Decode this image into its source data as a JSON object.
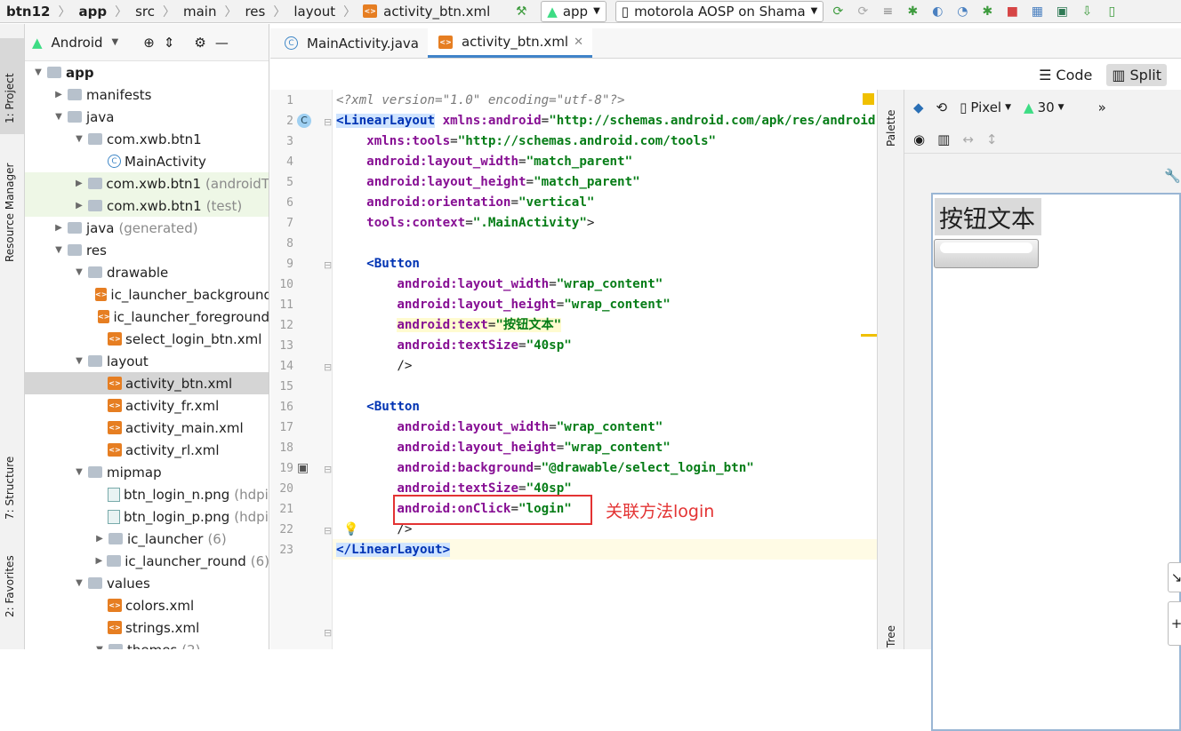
{
  "breadcrumb": [
    "btn12",
    "app",
    "src",
    "main",
    "res",
    "layout",
    "activity_btn.xml"
  ],
  "toolbar": {
    "config": "app",
    "device": "motorola AOSP on Shama"
  },
  "sidebar_tabs": {
    "project": "1: Project",
    "resource_manager": "Resource Manager",
    "structure": "7: Structure",
    "favorites": "2: Favorites"
  },
  "project_panel": {
    "view": "Android"
  },
  "tree": [
    {
      "label": "app",
      "extra": "",
      "indent": 0,
      "icon": "folder",
      "arrow": "down",
      "bold": true
    },
    {
      "label": "manifests",
      "extra": "",
      "indent": 1,
      "icon": "folder",
      "arrow": "right"
    },
    {
      "label": "java",
      "extra": "",
      "indent": 1,
      "icon": "folder",
      "arrow": "down"
    },
    {
      "label": "com.xwb.btn1",
      "extra": "",
      "indent": 2,
      "icon": "folder",
      "arrow": "down"
    },
    {
      "label": "MainActivity",
      "extra": "",
      "indent": 3,
      "icon": "class",
      "arrow": ""
    },
    {
      "label": "com.xwb.btn1",
      "extra": "(androidT",
      "indent": 2,
      "icon": "folder",
      "arrow": "right",
      "test": true
    },
    {
      "label": "com.xwb.btn1",
      "extra": "(test)",
      "indent": 2,
      "icon": "folder",
      "arrow": "right",
      "test": true
    },
    {
      "label": "java",
      "extra": "(generated)",
      "indent": 1,
      "icon": "folder",
      "arrow": "right"
    },
    {
      "label": "res",
      "extra": "",
      "indent": 1,
      "icon": "folder",
      "arrow": "down"
    },
    {
      "label": "drawable",
      "extra": "",
      "indent": 2,
      "icon": "folder",
      "arrow": "down"
    },
    {
      "label": "ic_launcher_background",
      "extra": "",
      "indent": 3,
      "icon": "xml",
      "arrow": ""
    },
    {
      "label": "ic_launcher_foreground",
      "extra": "",
      "indent": 3,
      "icon": "xml",
      "arrow": ""
    },
    {
      "label": "select_login_btn.xml",
      "extra": "",
      "indent": 3,
      "icon": "xml",
      "arrow": ""
    },
    {
      "label": "layout",
      "extra": "",
      "indent": 2,
      "icon": "folder",
      "arrow": "down"
    },
    {
      "label": "activity_btn.xml",
      "extra": "",
      "indent": 3,
      "icon": "xml",
      "arrow": "",
      "selected": true
    },
    {
      "label": "activity_fr.xml",
      "extra": "",
      "indent": 3,
      "icon": "xml",
      "arrow": ""
    },
    {
      "label": "activity_main.xml",
      "extra": "",
      "indent": 3,
      "icon": "xml",
      "arrow": ""
    },
    {
      "label": "activity_rl.xml",
      "extra": "",
      "indent": 3,
      "icon": "xml",
      "arrow": ""
    },
    {
      "label": "mipmap",
      "extra": "",
      "indent": 2,
      "icon": "folder",
      "arrow": "down"
    },
    {
      "label": "btn_login_n.png",
      "extra": "(hdpi",
      "indent": 3,
      "icon": "png",
      "arrow": ""
    },
    {
      "label": "btn_login_p.png",
      "extra": "(hdpi",
      "indent": 3,
      "icon": "png",
      "arrow": ""
    },
    {
      "label": "ic_launcher",
      "extra": "(6)",
      "indent": 3,
      "icon": "folder",
      "arrow": "right"
    },
    {
      "label": "ic_launcher_round",
      "extra": "(6)",
      "indent": 3,
      "icon": "folder",
      "arrow": "right"
    },
    {
      "label": "values",
      "extra": "",
      "indent": 2,
      "icon": "folder",
      "arrow": "down"
    },
    {
      "label": "colors.xml",
      "extra": "",
      "indent": 3,
      "icon": "xml",
      "arrow": ""
    },
    {
      "label": "strings.xml",
      "extra": "",
      "indent": 3,
      "icon": "xml",
      "arrow": ""
    },
    {
      "label": "themes",
      "extra": "(2)",
      "indent": 3,
      "icon": "folder",
      "arrow": "down"
    }
  ],
  "tabs": [
    {
      "label": "MainActivity.java",
      "icon": "class"
    },
    {
      "label": "activity_btn.xml",
      "icon": "xml",
      "active": true
    }
  ],
  "view_modes": {
    "code": "Code",
    "split": "Split"
  },
  "palette_label": "Palette",
  "tree_label": "Tree",
  "design_toolbar": {
    "device": "Pixel",
    "api": "30"
  },
  "code": [
    [
      [
        "pi",
        "<?xml version=\"1.0\" encoding=\"utf-8\"?>"
      ]
    ],
    [
      [
        "tag hl",
        "<LinearLayout"
      ],
      [
        "",
        ""
      ],
      [
        "attr",
        " xmlns:android"
      ],
      [
        "",
        "="
      ],
      [
        "val",
        "\"http://schemas.android.com/apk/res/android\""
      ]
    ],
    [
      [
        "",
        "    "
      ],
      [
        "attr",
        "xmlns:tools"
      ],
      [
        "",
        "="
      ],
      [
        "val",
        "\"http://schemas.android.com/tools\""
      ]
    ],
    [
      [
        "",
        "    "
      ],
      [
        "attr",
        "android:layout_width"
      ],
      [
        "",
        "="
      ],
      [
        "val",
        "\"match_parent\""
      ]
    ],
    [
      [
        "",
        "    "
      ],
      [
        "attr",
        "android:layout_height"
      ],
      [
        "",
        "="
      ],
      [
        "val",
        "\"match_parent\""
      ]
    ],
    [
      [
        "",
        "    "
      ],
      [
        "attr",
        "android:orientation"
      ],
      [
        "",
        "="
      ],
      [
        "val",
        "\"vertical\""
      ]
    ],
    [
      [
        "",
        "    "
      ],
      [
        "attr",
        "tools:context"
      ],
      [
        "",
        "="
      ],
      [
        "val",
        "\".MainActivity\""
      ],
      [
        "",
        ">"
      ]
    ],
    [
      [
        "",
        ""
      ]
    ],
    [
      [
        "",
        "    "
      ],
      [
        "tag",
        "<Button"
      ]
    ],
    [
      [
        "",
        "        "
      ],
      [
        "attr",
        "android:layout_width"
      ],
      [
        "",
        "="
      ],
      [
        "val",
        "\"wrap_content\""
      ]
    ],
    [
      [
        "",
        "        "
      ],
      [
        "attr",
        "android:layout_height"
      ],
      [
        "",
        "="
      ],
      [
        "val",
        "\"wrap_content\""
      ]
    ],
    [
      [
        "",
        "        "
      ],
      [
        "attr hl2",
        "android:text"
      ],
      [
        "hl2",
        "="
      ],
      [
        "val hl2",
        "\"按钮文本\""
      ]
    ],
    [
      [
        "",
        "        "
      ],
      [
        "attr",
        "android:textSize"
      ],
      [
        "",
        "="
      ],
      [
        "val",
        "\"40sp\""
      ]
    ],
    [
      [
        "",
        "        />"
      ]
    ],
    [
      [
        "",
        ""
      ]
    ],
    [
      [
        "",
        "    "
      ],
      [
        "tag",
        "<Button"
      ]
    ],
    [
      [
        "",
        "        "
      ],
      [
        "attr",
        "android:layout_width"
      ],
      [
        "",
        "="
      ],
      [
        "val",
        "\"wrap_content\""
      ]
    ],
    [
      [
        "",
        "        "
      ],
      [
        "attr",
        "android:layout_height"
      ],
      [
        "",
        "="
      ],
      [
        "val",
        "\"wrap_content\""
      ]
    ],
    [
      [
        "",
        "        "
      ],
      [
        "attr",
        "android:background"
      ],
      [
        "",
        "="
      ],
      [
        "val",
        "\"@drawable/select_login_btn\""
      ]
    ],
    [
      [
        "",
        "        "
      ],
      [
        "attr",
        "android:textSize"
      ],
      [
        "",
        "="
      ],
      [
        "val",
        "\"40sp\""
      ]
    ],
    [
      [
        "",
        "        "
      ],
      [
        "attr",
        "android:onClick"
      ],
      [
        "",
        "="
      ],
      [
        "val",
        "\"login\""
      ]
    ],
    [
      [
        "",
        "        />"
      ]
    ],
    [
      [
        "tag hl",
        "</LinearLayout>"
      ]
    ]
  ],
  "annotation": "关联方法login",
  "preview": {
    "button_text": "按钮文本"
  }
}
